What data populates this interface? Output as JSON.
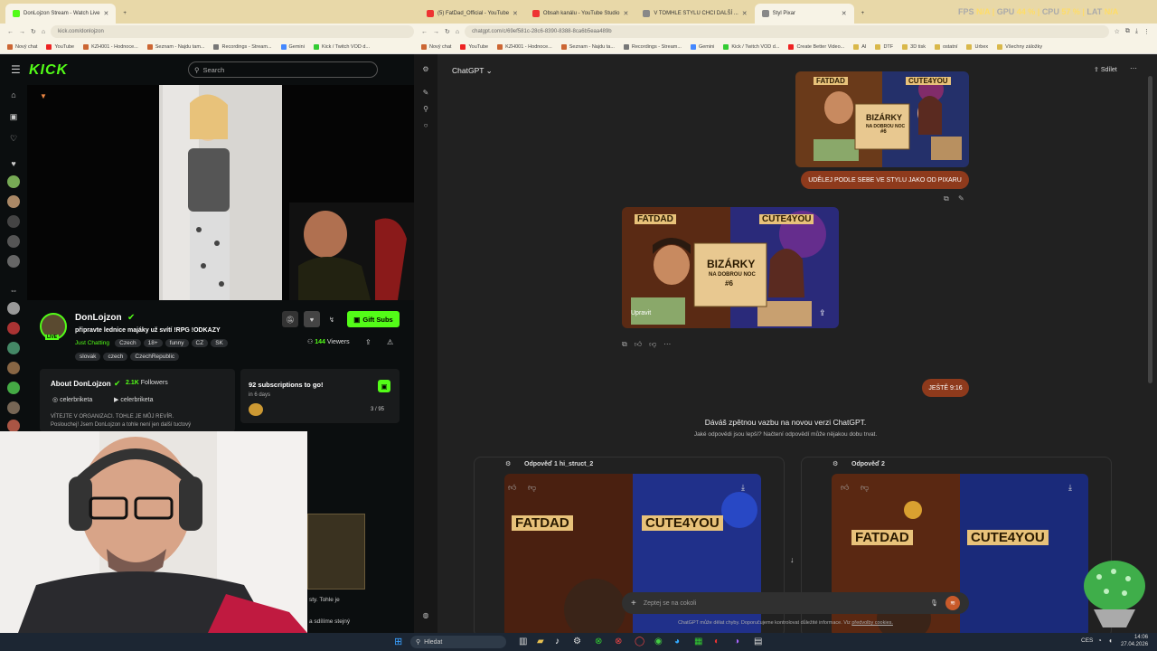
{
  "left_browser": {
    "tabs": [
      {
        "title": "DonLojzon Stream - Watch Live"
      }
    ],
    "url": "kick.com/donlojzon",
    "bookmarks": [
      "Nový chat",
      "YouTube",
      "KZH001 - Hodnoce...",
      "Seznam - Najdu tam...",
      "Recordings - Stream...",
      "Gemini",
      "Kick / Twitch VOD d..."
    ]
  },
  "right_browser": {
    "tabs": [
      {
        "title": "(5) FatDad_Official - YouTube"
      },
      {
        "title": "Obsah kanálu - YouTube Studio"
      },
      {
        "title": "V TOMHLE STYLU CHCI DALŠÍ ..."
      },
      {
        "title": "Styl Pixar"
      }
    ],
    "url": "chatgpt.com/c/69ef581c-28c6-8390-8388-8ca6b5eaa489b",
    "bookmarks": [
      "Nový chat",
      "YouTube",
      "KZH001 - Hodnoce...",
      "Seznam - Najdu ta...",
      "Recordings - Stream...",
      "Gemini",
      "Kick / Twitch VOD d...",
      "Create Better Video...",
      "AI",
      "DTF",
      "3D tisk",
      "ostatní",
      "Urbex",
      "Všechny záložky"
    ]
  },
  "hud": {
    "fps_label": "FPS",
    "fps": "N/A",
    "gpu_label": "GPU",
    "gpu": "44 %",
    "cpu_label": "CPU",
    "cpu": "57 %",
    "lat_label": "LAT",
    "lat": "N/A"
  },
  "kick": {
    "logo": "KICK",
    "search_placeholder": "Search",
    "channel": {
      "name": "DonLojzon",
      "title": "připravte lednice majáky už svítí !RPG !ODKAZY",
      "category": "Just Chatting",
      "tags_row1": [
        "Czech",
        "18+",
        "funny",
        "CZ",
        "SK"
      ],
      "tags_row2": [
        "slovak",
        "czech",
        "CzechRepublic"
      ],
      "viewers": "144",
      "viewers_label": "Viewers",
      "gift_button": "Gift Subs",
      "live_badge": "LIVE"
    },
    "about": {
      "title": "About DonLojzon",
      "followers": "2.1K",
      "followers_label": "Followers",
      "social1": "celerbriketa",
      "social2": "celerbriketa",
      "bio_line1": "VÍTEJTE V ORGANIZACI. TOHLE JE MŮJ REVÍR.",
      "bio_line2": "Poslouchej! Jsem DonLojzon a tohle není jen další tuctový"
    },
    "subs_goal": {
      "title": "92 subscriptions to go!",
      "subtitle": "in 6 days",
      "progress": "3 / 95",
      "progress_fraction": 0.032
    },
    "below_text1": "sty. Tohle je",
    "below_text2": "a sdílíme stejný"
  },
  "chatgpt": {
    "title": "ChatGPT",
    "share": "Sdílet",
    "user_image_text": {
      "left": "FATDAD",
      "right": "CUTE4YOU",
      "center": "BIZÁRKY",
      "sub": "NA DOBROU NOC",
      "num": "#6"
    },
    "user_message": "UDĚLEJ PODLE SEBE VE STYLU JAKO OD PIXARU",
    "response_image_text": {
      "left": "FATDAD",
      "right": "CUTE4YOU",
      "center": "BIZÁRKY",
      "sub": "NA DOBROU NOC",
      "num": "#6"
    },
    "edit_label": "Upravit",
    "user_message2": "JEŠTĚ 9:16",
    "feedback_title": "Dáváš zpětnou vazbu na novou verzi ChatGPT.",
    "feedback_sub": "Jaké odpovědi jsou lepší? Načtení odpovědí může nějakou dobu trvat.",
    "resp1_label": "Odpověď 1 hi_struct_2",
    "resp2_label": "Odpověď 2",
    "resp_img_left": "FATDAD",
    "resp_img_right": "CUTE4YOU",
    "input_placeholder": "Zeptej se na cokoli",
    "disclaimer": "ChatGPT může dělat chyby. Doporučujeme kontrolovat důležité informace. Viz",
    "disclaimer_link": "předvolby cookies."
  },
  "taskbar": {
    "search": "Hledat",
    "lang": "CES",
    "time": "14:06",
    "date": "27.04.2026"
  }
}
